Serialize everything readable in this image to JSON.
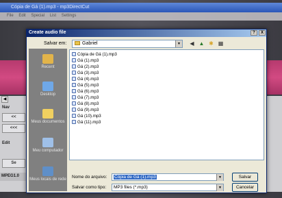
{
  "background_app": {
    "title": "Cópia de Gá (1).mp3 - mp3DirectCut",
    "menu": [
      "File",
      "Edit",
      "Special",
      "List",
      "Settings"
    ],
    "left_panel": {
      "nav_label": "Nav",
      "rewind_label": "<<",
      "fast_rewind_label": "<<<",
      "edit_label": "Edit",
      "se_label": "Se",
      "status": "MPEG1.0"
    }
  },
  "dialog": {
    "title": "Create audio file",
    "help_label": "?",
    "close_label": "X",
    "look_in_label": "Salvar em:",
    "look_in_value": "Gabriel",
    "places": [
      {
        "label": "Recent",
        "icon": "recent-icon"
      },
      {
        "label": "Desktop",
        "icon": "desktop-icon"
      },
      {
        "label": "Meus documentos",
        "icon": "my-documents-icon"
      },
      {
        "label": "Meu computador",
        "icon": "my-computer-icon"
      },
      {
        "label": "Meus locais de rede",
        "icon": "network-icon"
      }
    ],
    "files": [
      "Cópia de Gá (1).mp3",
      "Gá (1).mp3",
      "Gá (2).mp3",
      "Gá (3).mp3",
      "Gá (4).mp3",
      "Gá (5).mp3",
      "Gá (6).mp3",
      "Gá (7).mp3",
      "Gá (8).mp3",
      "Gá (9).mp3",
      "Gá (10).mp3",
      "Gá (11).mp3"
    ],
    "filename_label": "Nome do arquivo:",
    "filename_value": "Cópia de Gá (1).mp3",
    "filetype_label": "Salvar como tipo:",
    "filetype_value": "MP3 files (*.mp3)",
    "save_label": "Salvar",
    "cancel_label": "Cancelar"
  },
  "colors": {
    "dialog_title_start": "#0a246a",
    "dialog_title_end": "#a6caf0",
    "app_band": "#c6427a",
    "selection": "#316ac5"
  }
}
